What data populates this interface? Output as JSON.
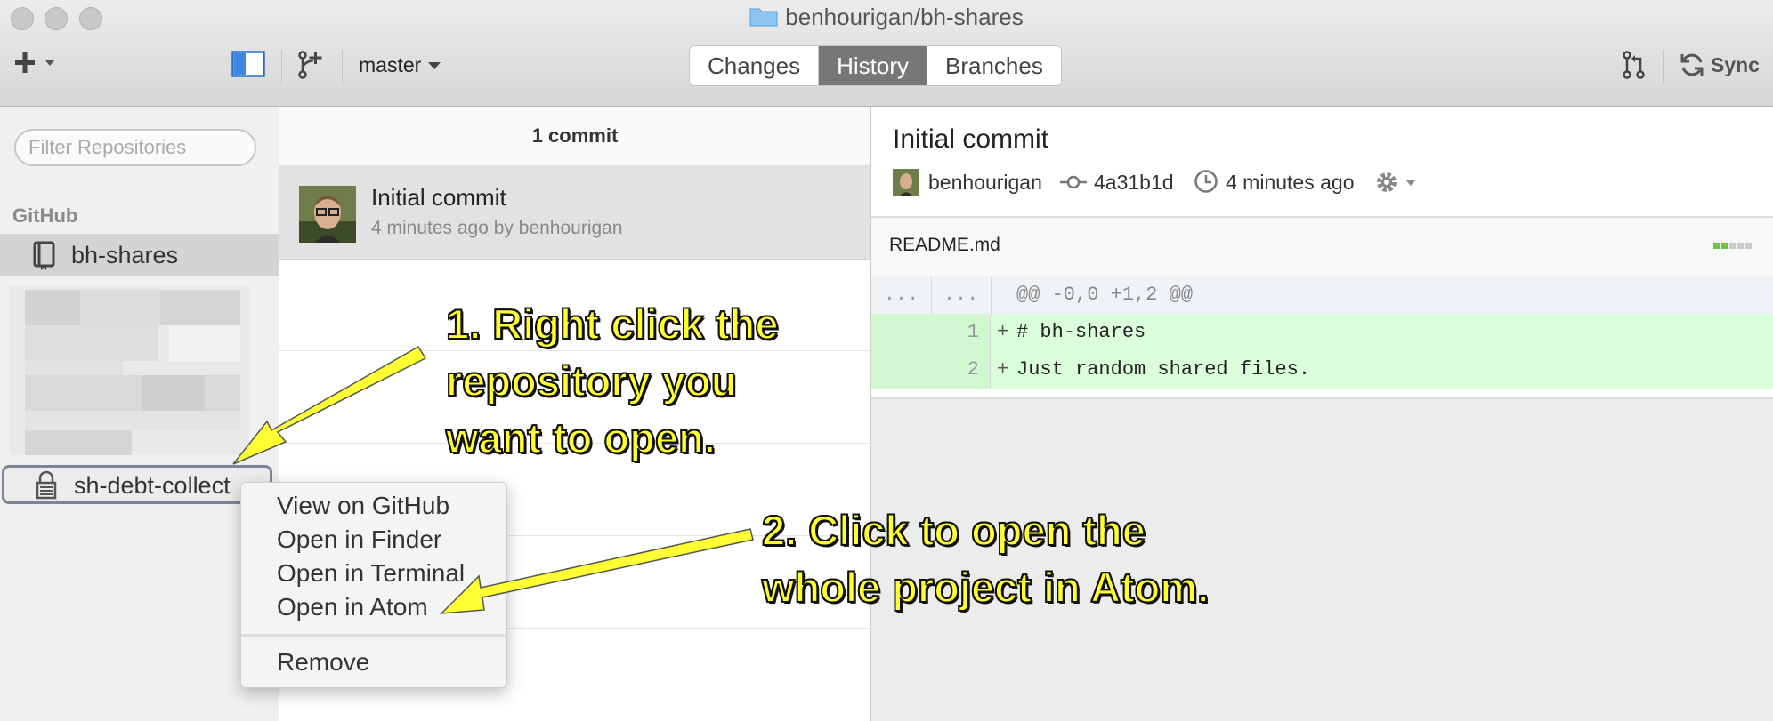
{
  "window": {
    "title": "benhourigan/bh-shares"
  },
  "toolbar": {
    "branch": "master",
    "tabs": [
      {
        "label": "Changes",
        "active": false
      },
      {
        "label": "History",
        "active": true
      },
      {
        "label": "Branches",
        "active": false
      }
    ],
    "sync_label": "Sync"
  },
  "sidebar": {
    "filter_placeholder": "Filter Repositories",
    "section_label": "GitHub",
    "repos": [
      {
        "name": "bh-shares",
        "selected": true
      },
      {
        "name": "sh-debt-collect",
        "private": true
      }
    ]
  },
  "commit_list": {
    "header": "1 commit",
    "commits": [
      {
        "title": "Initial commit",
        "meta": "4 minutes ago by benhourigan"
      }
    ]
  },
  "detail": {
    "title": "Initial commit",
    "author": "benhourigan",
    "sha": "4a31b1d",
    "time": "4 minutes ago",
    "file": "README.md",
    "diff": {
      "hunk_header": "@@ -0,0 +1,2 @@",
      "ellipsis": "...",
      "lines": [
        {
          "num": "1",
          "sign": "+",
          "text": "# bh-shares"
        },
        {
          "num": "2",
          "sign": "+",
          "text": "Just random shared files."
        }
      ]
    }
  },
  "context_menu": {
    "items": [
      "View on GitHub",
      "Open in Finder",
      "Open in Terminal",
      "Open in Atom"
    ],
    "remove": "Remove"
  },
  "annotations": {
    "step1": [
      "1. Right click the",
      "repository you",
      "want to open."
    ],
    "step2": [
      "2. Click to open the",
      "whole project in Atom."
    ]
  },
  "colors": {
    "annotation": "#ffff33",
    "diff_added": "#e6ffe6",
    "active_tab": "#777777"
  }
}
